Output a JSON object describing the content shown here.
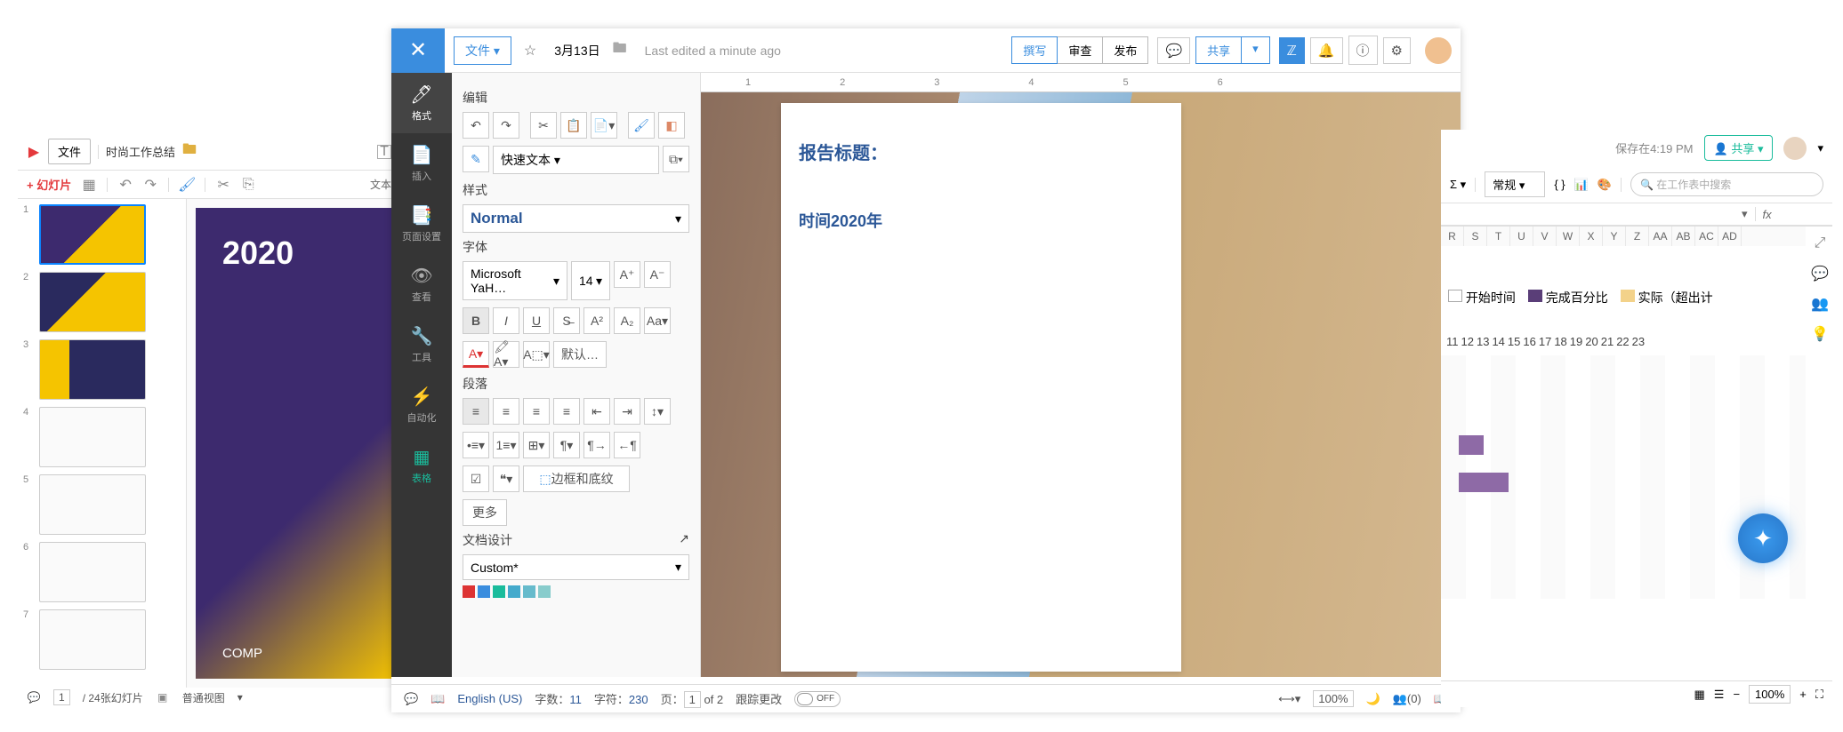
{
  "slides": {
    "file_btn": "文件",
    "title": "时尚工作总结",
    "add_slide": "+ 幻灯片",
    "tool_label": "文本",
    "thumbs": [
      "1",
      "2",
      "3",
      "4",
      "5",
      "6",
      "7"
    ],
    "big_year": "2020",
    "comp_label": "COMP",
    "status_page": "1",
    "status_total": "/ 24张幻灯片",
    "status_view": "普通视图"
  },
  "writer": {
    "file_btn": "文件 ▾",
    "date": "3月13日",
    "last_edited": "Last edited a minute ago",
    "sidebar": {
      "format": "格式",
      "insert": "插入",
      "page": "页面设置",
      "view": "查看",
      "tools": "工具",
      "auto": "自动化",
      "table": "表格"
    },
    "modes": {
      "compose": "撰写",
      "review": "审查",
      "publish": "发布"
    },
    "share": "共享",
    "edit_h": "编辑",
    "quick_text": "快速文本 ▾",
    "style_h": "样式",
    "style_val": "Normal",
    "font_h": "字体",
    "font_name": "Microsoft YaH…",
    "font_size": "14",
    "size_up": "A⁺",
    "size_dn": "A⁻",
    "default_btn": "默认…",
    "para_h": "段落",
    "border_btn": "边框和底纹",
    "more_btn": "更多",
    "docdesign_h": "文档设计",
    "docdesign_val": "Custom*",
    "ruler": [
      "1",
      "2",
      "3",
      "4",
      "5",
      "6"
    ],
    "doc_title": "报告标题：",
    "doc_time": "时间2020年",
    "status": {
      "lang": "English (US)",
      "words_lbl": "字数：",
      "words": "11",
      "chars_lbl": "字符：",
      "chars": "230",
      "page_lbl": "页：",
      "page": "1",
      "of": "of 2",
      "track": "跟踪更改",
      "track_off": "OFF",
      "zoom": "100%",
      "ppl": "(0)"
    }
  },
  "sheet": {
    "autosave": "保存在4:19 PM",
    "share": "共享",
    "sum": "Σ ▾",
    "format_sel": "常规",
    "search_placeholder": "在工作表中搜索",
    "fx": "fx",
    "cols": [
      "S",
      "T",
      "U",
      "V",
      "W",
      "X",
      "Y",
      "Z",
      "AA",
      "AB",
      "AC",
      "AD"
    ],
    "adj": "R",
    "legend": [
      {
        "label": "开始时间",
        "color": "#ffffff"
      },
      {
        "label": "完成百分比",
        "color": "#5a3e78"
      },
      {
        "label": "实际（超出计",
        "color": "#f3d28a"
      }
    ],
    "nums": [
      "11",
      "12",
      "13",
      "14",
      "15",
      "16",
      "17",
      "18",
      "19",
      "20",
      "21",
      "22",
      "23"
    ],
    "zoom": "100%"
  },
  "chart_data": {
    "type": "bar",
    "orientation": "horizontal",
    "title": "",
    "xlabel": "",
    "ylabel": "",
    "series": [
      {
        "name": "开始时间",
        "color": "#ffffff"
      },
      {
        "name": "完成百分比",
        "color": "#5a3e78"
      },
      {
        "name": "实际（超出计",
        "color": "#f3d28a"
      }
    ],
    "x_ticks": [
      11,
      12,
      13,
      14,
      15,
      16,
      17,
      18,
      19,
      20,
      21,
      22,
      23
    ],
    "visible_bars": [
      {
        "row": 1,
        "start": 11,
        "end": 12
      },
      {
        "row": 2,
        "start": 11,
        "end": 13
      }
    ],
    "note": "partial gantt-style chart visible at right edge of screenshot"
  }
}
